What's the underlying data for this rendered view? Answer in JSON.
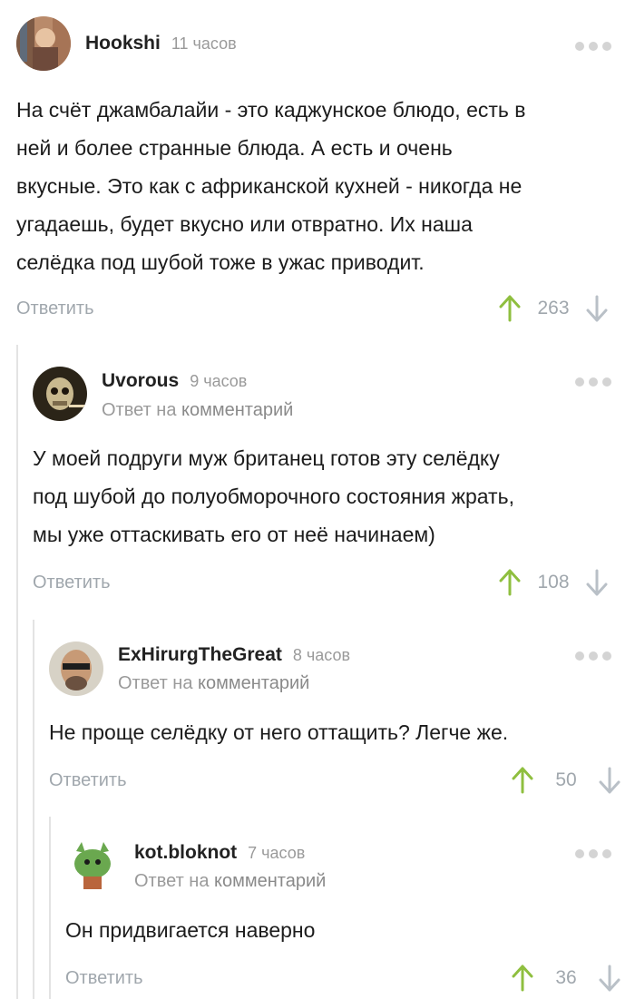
{
  "reply_label": "Ответить",
  "reply_to_prefix": "Ответ на",
  "reply_to_link": "комментарий",
  "colors": {
    "upvote": "#8fbf3f",
    "downvote": "#b9c0c7",
    "muted": "#a0a7ad"
  },
  "comments": [
    {
      "username": "Hookshi",
      "time": "11 часов",
      "text_lines": [
        "На счёт джамбалайи - это каджунское блюдо, есть в",
        "ней и более странные блюда. А есть и очень",
        "вкусные. Это как с африканской кухней - никогда не",
        "угадаешь, будет вкусно или отвратно. Их наша",
        "селёдка под шубой тоже в ужас приводит."
      ],
      "rating": "263"
    },
    {
      "username": "Uvorous",
      "time": "9 часов",
      "text_lines": [
        "У моей подруги муж британец готов эту селёдку",
        "под шубой до полуобморочного состояния жрать,",
        "мы уже оттаскивать его от неё начинаем)"
      ],
      "rating": "108"
    },
    {
      "username": "ExHirurgTheGreat",
      "time": "8 часов",
      "text_lines": [
        "Не проще селёдку от него оттащить? Легче же."
      ],
      "rating": "50"
    },
    {
      "username": "kot.bloknot",
      "time": "7 часов",
      "text_lines": [
        "Он придвигается наверно"
      ],
      "rating": "36"
    }
  ]
}
